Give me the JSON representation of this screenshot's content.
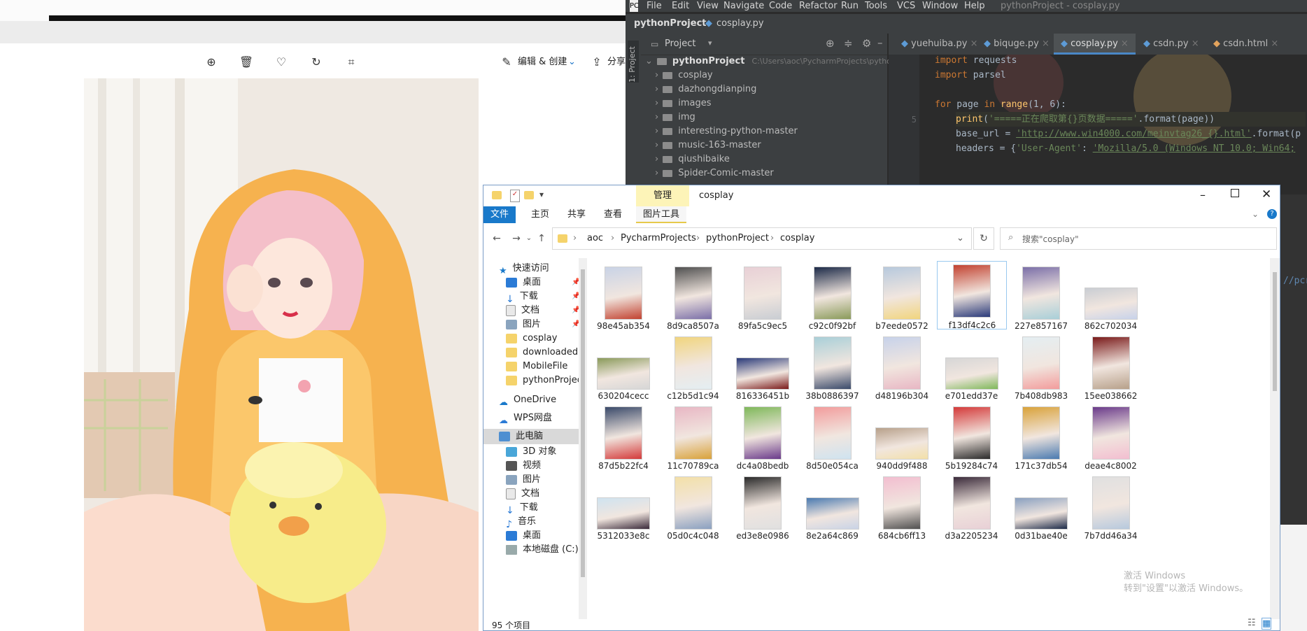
{
  "viewer": {
    "toolbar": {
      "edit_label": "编辑 & 创建",
      "share_label": "分享"
    }
  },
  "ide": {
    "menu": [
      "File",
      "Edit",
      "View",
      "Navigate",
      "Code",
      "Refactor",
      "Run",
      "Tools",
      "VCS",
      "Window",
      "Help"
    ],
    "window_title": "pythonProject - cosplay.py",
    "breadcrumb_project": "pythonProject",
    "breadcrumb_file": "cosplay.py",
    "sidebar_label": "1: Project",
    "project_header": "Project",
    "tree": {
      "root_name": "pythonProject",
      "root_path": "C:\\Users\\aoc\\PycharmProjects\\pythonProject",
      "folders": [
        "cosplay",
        "dazhongdianping",
        "images",
        "img",
        "interesting-python-master",
        "music-163-master",
        "qiushibaike",
        "Spider-Comic-master"
      ]
    },
    "tabs": [
      "yuehuiba.py",
      "biquge.py",
      "cosplay.py",
      "csdn.py",
      "csdn.html"
    ],
    "active_tab": "cosplay.py",
    "code": {
      "line1_kw": "import",
      "line1_rest": " requests",
      "line2_kw": "import",
      "line2_rest": " parsel",
      "line4_kw": "for",
      "line4_a": " page ",
      "line4_kw2": "in",
      "line4_fn": " range",
      "line4_b": "(1, 6):",
      "line5_fn": "print",
      "line5_a": "(",
      "line5_str": "'=====正在爬取第{}页数据====='",
      "line5_b": ".format(page))",
      "line6_a": "base_url = ",
      "line6_str": "'http://www.win4000.com/meinvtag26_{}.html'",
      "line6_b": ".format(p",
      "line7_a": "headers = {",
      "line7_str1": "'User-Agent'",
      "line7_b": ": ",
      "line7_str2": "'Mozilla/5.0 (Windows NT 10.0; Win64;"
    },
    "line_number": "5",
    "side_fragment": "//pcro"
  },
  "explorer": {
    "manage_label": "管理",
    "title": "cosplay",
    "ribbon": {
      "file": "文件",
      "home": "主页",
      "share": "共享",
      "view": "查看",
      "picture_tools": "图片工具"
    },
    "breadcrumbs": [
      "aoc",
      "PycharmProjects",
      "pythonProject",
      "cosplay"
    ],
    "search_placeholder": "搜索\"cosplay\"",
    "nav": {
      "quick_access": "快速访问",
      "desktop": "桌面",
      "downloads": "下载",
      "documents": "文档",
      "pictures": "图片",
      "cosplay": "cosplay",
      "downloaded": "downloaded",
      "mobilefile": "MobileFile",
      "pythonproject": "pythonProject",
      "onedrive": "OneDrive",
      "wps": "WPS网盘",
      "this_pc": "此电脑",
      "objects3d": "3D 对象",
      "videos": "视频",
      "pictures2": "图片",
      "documents2": "文档",
      "downloads2": "下载",
      "music": "音乐",
      "desktop2": "桌面",
      "local_disk": "本地磁盘 (C:)"
    },
    "status": "95 个项目",
    "files": [
      [
        "98e45ab354",
        "8d9ca8507a",
        "89fa5c9ec5",
        "c92c0f92bf",
        "b7eede0572",
        "f13df4c2c6",
        "227e857167",
        "862c702034"
      ],
      [
        "630204cecc",
        "c12b5d1c94",
        "816336451b",
        "38b0886397",
        "d48196b304",
        "e701edd37e",
        "7b408db983",
        "15ee038662"
      ],
      [
        "87d5b22fc4",
        "11c70789ca",
        "dc4a08bedb",
        "8d50e054ca",
        "940dd9f488",
        "5b19284c74",
        "171c37db54",
        "deae4c8002"
      ],
      [
        "5312033e8c",
        "05d0c4c048",
        "ed3e8e0986",
        "8e2a64c869",
        "684cb6ff13",
        "d3a2205234",
        "0d31bae40e",
        "7b7dd46a34"
      ]
    ],
    "selected_file": "f13df4c2c6"
  },
  "watermark": {
    "line1": "激活 Windows",
    "line2": "转到\"设置\"以激活 Windows。"
  }
}
